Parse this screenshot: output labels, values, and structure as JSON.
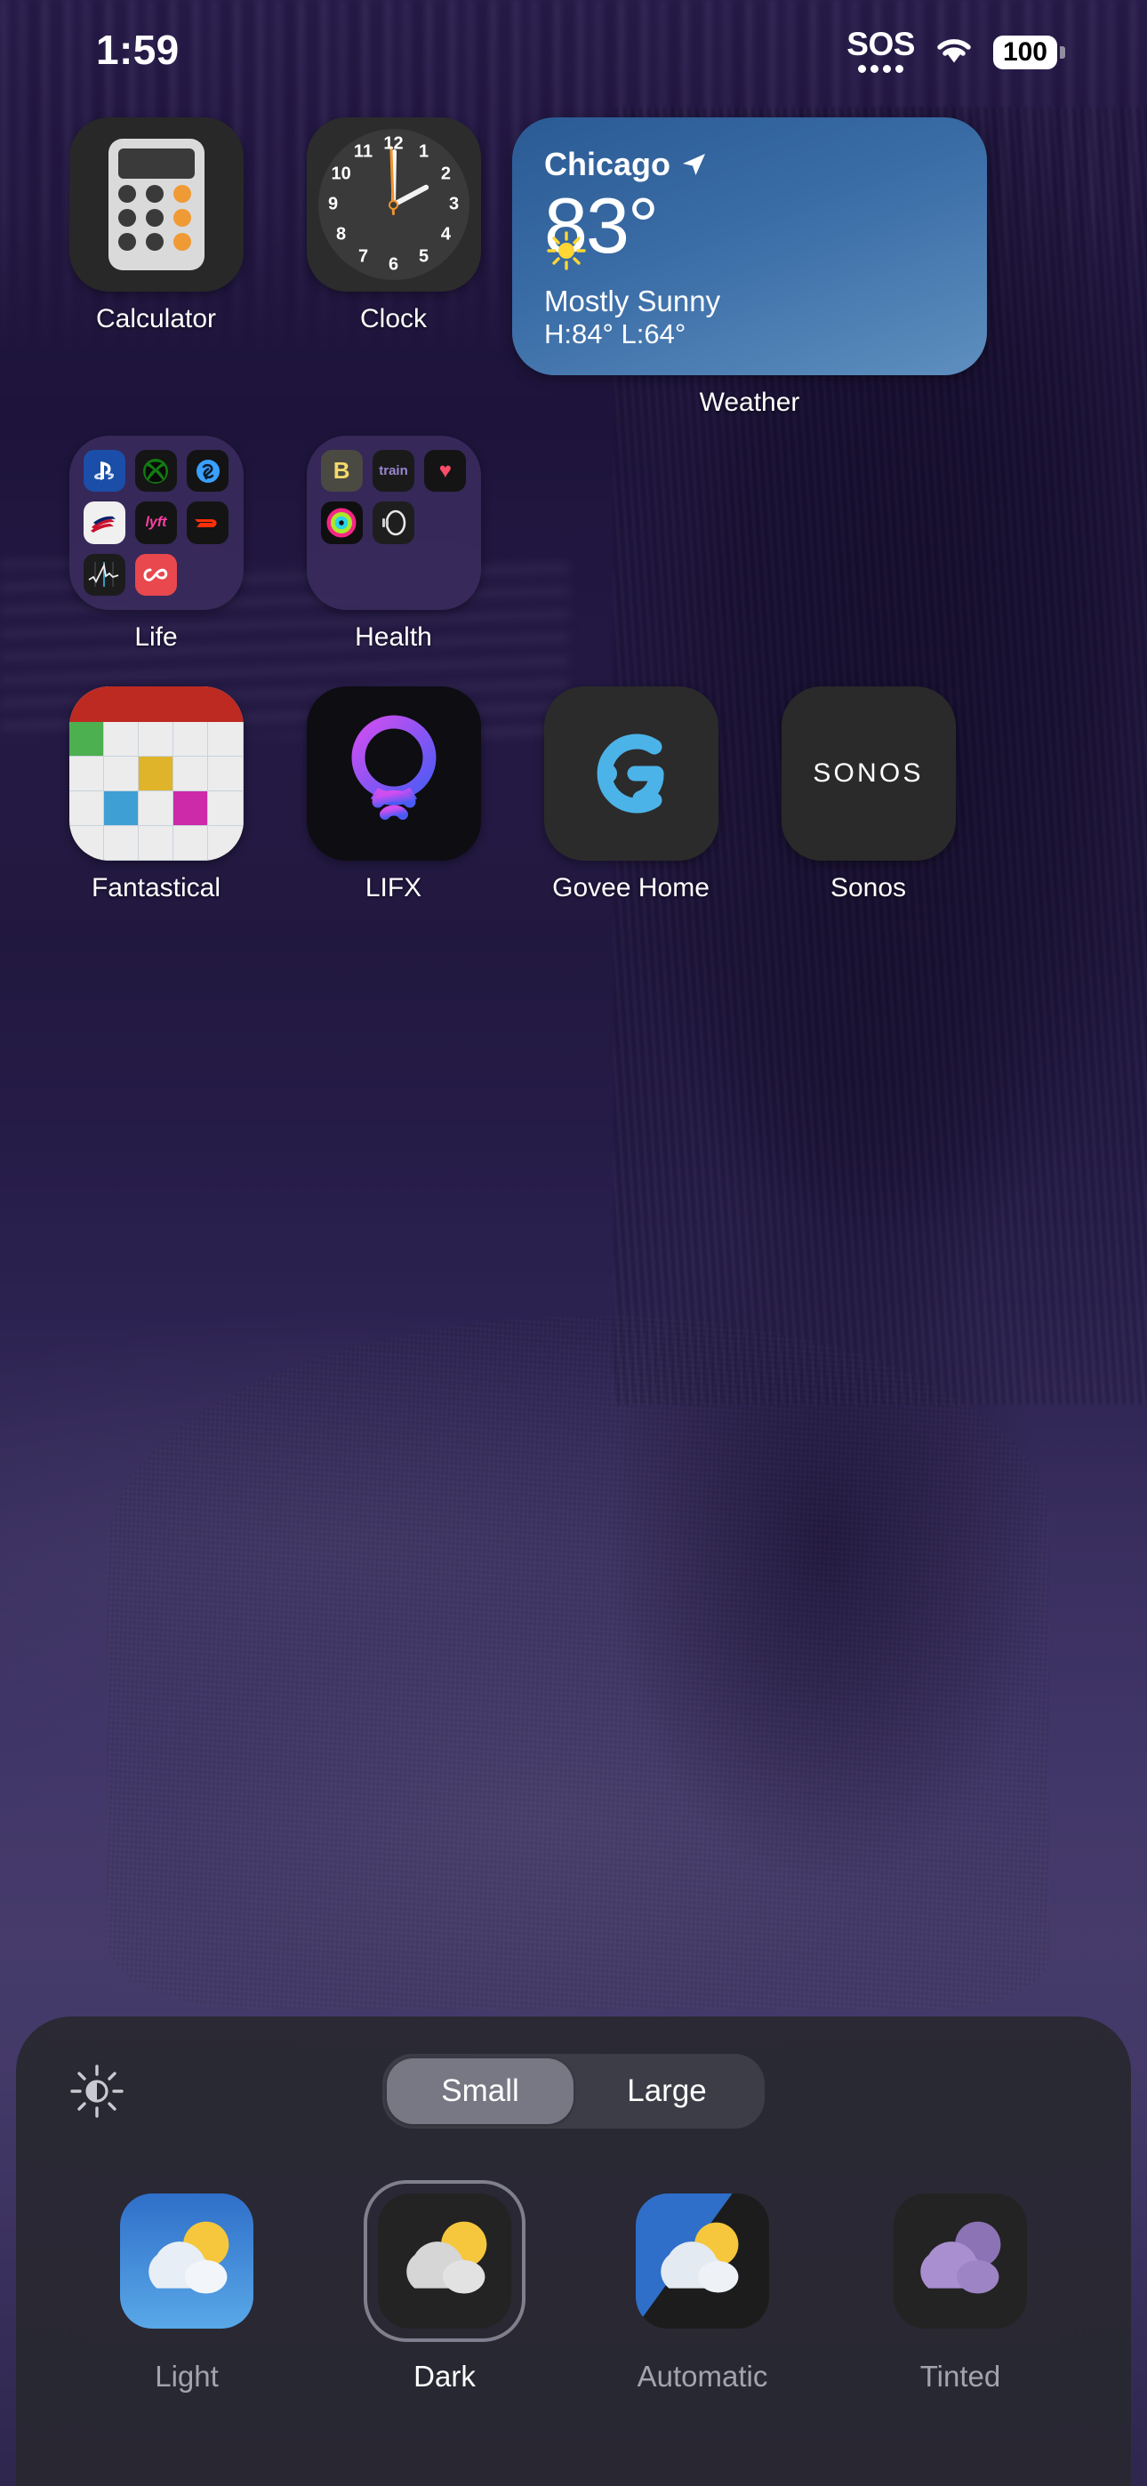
{
  "status_bar": {
    "time": "1:59",
    "sos_label": "SOS",
    "wifi_icon": "wifi-icon",
    "battery_percent": "100"
  },
  "home_screen": {
    "rows": [
      {
        "items": [
          {
            "type": "app",
            "label": "Calculator",
            "icon": "calculator-icon"
          },
          {
            "type": "app",
            "label": "Clock",
            "icon": "clock-icon"
          },
          {
            "type": "widget",
            "label": "Weather",
            "icon": "weather-widget"
          }
        ]
      },
      {
        "items": [
          {
            "type": "folder",
            "label": "Life",
            "icon": "folder-icon"
          },
          {
            "type": "folder",
            "label": "Health",
            "icon": "folder-icon"
          }
        ]
      },
      {
        "items": [
          {
            "type": "app",
            "label": "Fantastical",
            "icon": "fantastical-icon"
          },
          {
            "type": "app",
            "label": "LIFX",
            "icon": "lifx-icon"
          },
          {
            "type": "app",
            "label": "Govee Home",
            "icon": "govee-home-icon"
          },
          {
            "type": "app",
            "label": "Sonos",
            "icon": "sonos-icon"
          }
        ]
      }
    ],
    "folders": {
      "life": {
        "label": "Life",
        "apps": [
          {
            "name": "PlayStation",
            "icon": "playstation-icon",
            "bg": "#1b4ea8",
            "glyph": "Ⓟ"
          },
          {
            "name": "Xbox",
            "icon": "xbox-icon",
            "bg": "#151515",
            "glyph": ""
          },
          {
            "name": "Shazam",
            "icon": "shazam-icon",
            "bg": "#131313",
            "glyph": ""
          },
          {
            "name": "Bank of America",
            "icon": "bank-of-america-icon",
            "bg": "#f0f0f0",
            "glyph": ""
          },
          {
            "name": "Lyft",
            "icon": "lyft-icon",
            "bg": "#141414",
            "glyph": "lyft"
          },
          {
            "name": "DoorDash",
            "icon": "doordash-icon",
            "bg": "#141414",
            "glyph": ""
          },
          {
            "name": "Stocks",
            "icon": "stocks-icon",
            "bg": "#1c1c1c",
            "glyph": ""
          },
          {
            "name": "Authy",
            "icon": "authy-icon",
            "bg": "#e8484e",
            "glyph": ""
          }
        ]
      },
      "health": {
        "label": "Health",
        "apps": [
          {
            "name": "Bevel",
            "icon": "bevel-icon",
            "bg": "#4a4a42",
            "glyph": "B"
          },
          {
            "name": "Train",
            "icon": "train-icon",
            "bg": "#1a1a1a",
            "glyph": "train"
          },
          {
            "name": "Health",
            "icon": "health-icon",
            "bg": "#141414",
            "glyph": "♥"
          },
          {
            "name": "Fitness",
            "icon": "fitness-icon",
            "bg": "#0f0f0f",
            "glyph": ""
          },
          {
            "name": "Oura",
            "icon": "oura-icon",
            "bg": "#1e1e1e",
            "glyph": ""
          }
        ]
      }
    },
    "weather_widget": {
      "city": "Chicago",
      "location_icon": "location-arrow-icon",
      "temperature": "83°",
      "condition_icon": "sun-icon",
      "condition": "Mostly Sunny",
      "high_low": "H:84° L:64°",
      "label": "Weather",
      "accent": "#3a6ca6"
    }
  },
  "customize_panel": {
    "brightness_icon": "brightness-icon",
    "size_toggle": {
      "options": [
        "Small",
        "Large"
      ],
      "small_label": "Small",
      "large_label": "Large",
      "selected": "Small"
    },
    "appearance_modes": [
      {
        "label": "Light",
        "icon": "weather-light-icon",
        "selected": false
      },
      {
        "label": "Dark",
        "icon": "weather-dark-icon",
        "selected": true
      },
      {
        "label": "Automatic",
        "icon": "weather-automatic-icon",
        "selected": false
      },
      {
        "label": "Tinted",
        "icon": "weather-tinted-icon",
        "selected": false
      }
    ]
  }
}
